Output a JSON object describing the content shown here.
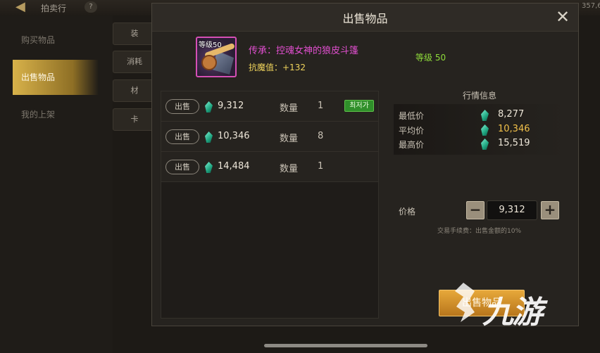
{
  "topbar": {
    "title": "拍卖行",
    "help": "?",
    "currency": "357,6"
  },
  "nav": {
    "items": [
      {
        "label": "购买物品",
        "active": false
      },
      {
        "label": "出售物品",
        "active": true
      },
      {
        "label": "我的上架",
        "active": false
      }
    ]
  },
  "subtabs": [
    "装",
    "消耗",
    "材",
    "卡"
  ],
  "dialog": {
    "title": "出售物品",
    "item": {
      "level_tag": "等级50",
      "name": "传承：控魂女神的狼皮斗篷",
      "stat": "抗魔值：+132",
      "grade": "等级 50"
    },
    "listings": [
      {
        "tag": "出售",
        "price": "9,312",
        "qty_label": "数量",
        "qty": "1",
        "badge": "최저가"
      },
      {
        "tag": "出售",
        "price": "10,346",
        "qty_label": "数量",
        "qty": "8",
        "badge": ""
      },
      {
        "tag": "出售",
        "price": "14,484",
        "qty_label": "数量",
        "qty": "1",
        "badge": ""
      }
    ],
    "market": {
      "title": "行情信息",
      "rows": [
        {
          "label": "最低价",
          "value": "8,277"
        },
        {
          "label": "平均价",
          "value": "10,346"
        },
        {
          "label": "最高价",
          "value": "15,519"
        }
      ]
    },
    "price": {
      "label": "价格",
      "value": "9,312",
      "minus": "−",
      "plus": "+"
    },
    "fee_note": "交易手续费：出售金额的10%",
    "sell_button": "出售物品"
  },
  "watermark": {
    "text": "九游"
  },
  "colors": {
    "accent": "#d8b24a",
    "sell_button": "#e7a83a",
    "item_name": "#e24fd0",
    "grade": "#8fdc3a"
  }
}
